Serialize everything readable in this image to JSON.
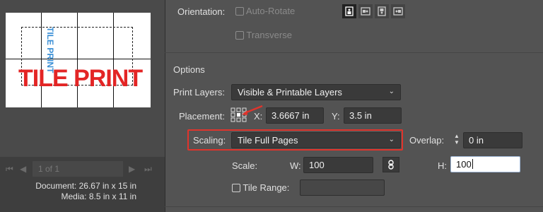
{
  "preview": {
    "sample_big": "TILE PRINT",
    "sample_vertical": "TILE PRINT",
    "page_field": "1 of 1",
    "document_label": "Document:",
    "document_value": "26.67 in x 15 in",
    "media_label": "Media:",
    "media_value": "8.5 in x 11 in"
  },
  "orientation": {
    "label": "Orientation:",
    "auto_rotate_label": "Auto-Rotate",
    "transverse_label": "Transverse",
    "buttons": [
      "portrait-icon",
      "landscape-icon",
      "reverse-portrait-icon",
      "reverse-landscape-icon"
    ]
  },
  "options": {
    "section_title": "Options",
    "print_layers_label": "Print Layers:",
    "print_layers_value": "Visible & Printable Layers",
    "placement_label": "Placement:",
    "x_label": "X:",
    "x_value": "3.6667 in",
    "y_label": "Y:",
    "y_value": "3.5 in",
    "scaling_label": "Scaling:",
    "scaling_value": "Tile Full Pages",
    "overlap_label": "Overlap:",
    "overlap_value": "0 in",
    "scale_label": "Scale:",
    "w_label": "W:",
    "w_value": "100",
    "h_label": "H:",
    "h_value": "100",
    "tile_range_label": "Tile Range:",
    "tile_range_value": ""
  },
  "colors": {
    "highlight": "#e0342c",
    "sample_red": "#e32525",
    "sample_blue": "#3a8fd6"
  }
}
